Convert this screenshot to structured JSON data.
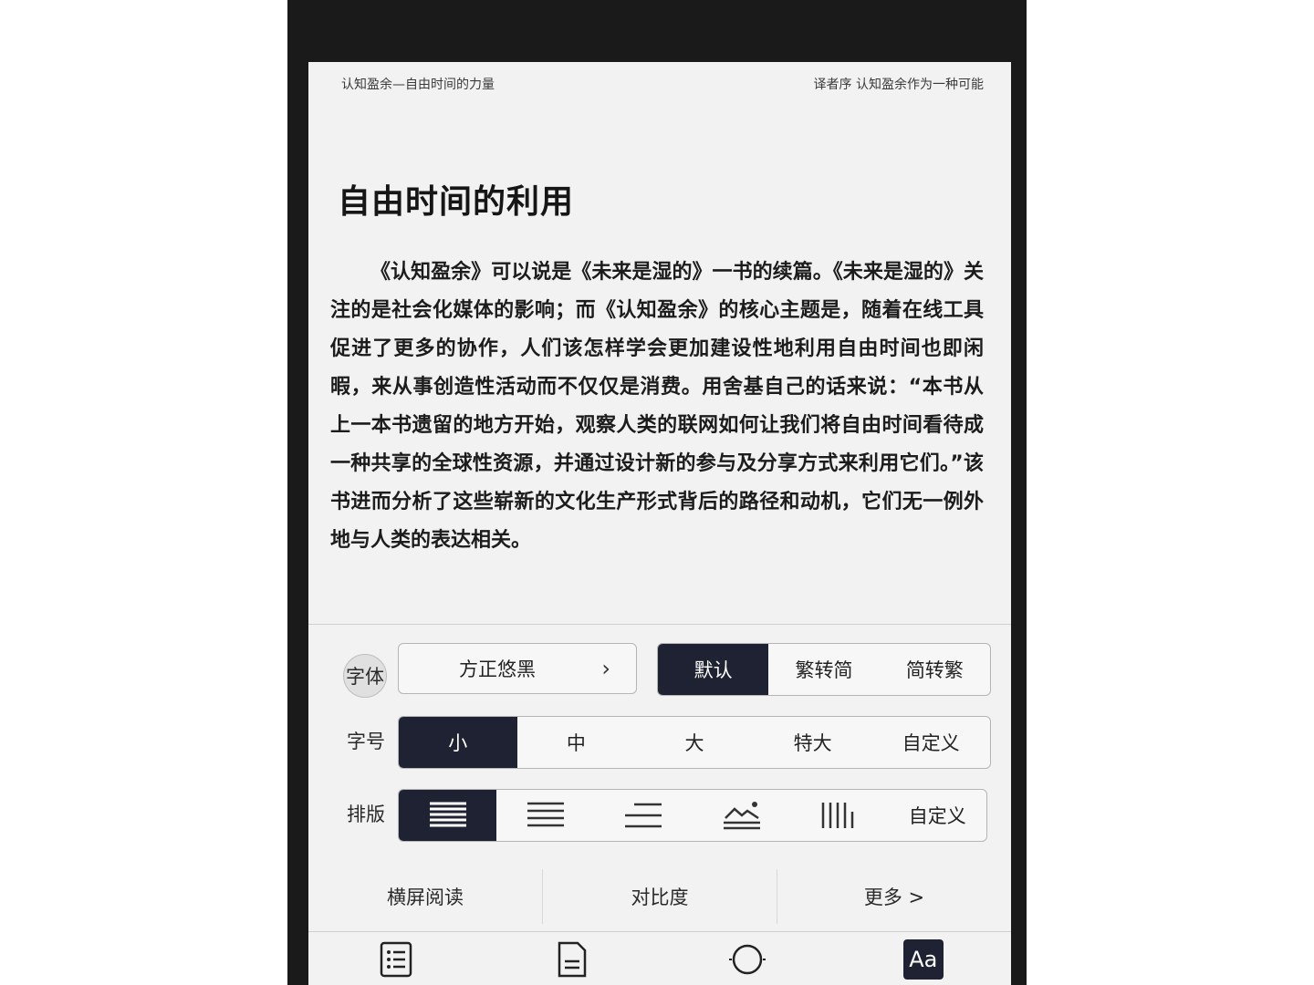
{
  "header": {
    "book_title": "认知盈余—自由时间的力量",
    "chapter": "译者序 认知盈余作为一种可能"
  },
  "content": {
    "title": "自由时间的利用",
    "paragraph": "《认知盈余》可以说是《未来是湿的》一书的续篇。《未来是湿的》关注的是社会化媒体的影响；而《认知盈余》的核心主题是，随着在线工具促进了更多的协作，人们该怎样学会更加建设性地利用自由时间也即闲暇，来从事创造性活动而不仅仅是消费。用舍基自己的话来说：“本书从上一本书遗留的地方开始，观察人类的联网如何让我们将自由时间看待成一种共享的全球性资源，并通过设计新的参与及分享方式来利用它们。”该书进而分析了这些崭新的文化生产形式背后的路径和动机，它们无一例外地与人类的表达相关。"
  },
  "settings": {
    "font_label": "字体",
    "font_value": "方正悠黑",
    "convert_options": [
      "默认",
      "繁转简",
      "简转繁"
    ],
    "size_label": "字号",
    "size_options": [
      "小",
      "中",
      "大",
      "特大",
      "自定义"
    ],
    "layout_label": "排版",
    "layout_custom": "自定义",
    "links": [
      "横屏阅读",
      "对比度",
      "更多 >"
    ]
  },
  "toolbar": {
    "aa_label": "Aa",
    "icons": [
      "toc-icon",
      "page-icon",
      "brightness-icon",
      "font-settings-icon"
    ]
  },
  "colors": {
    "active_bg": "#1e2232",
    "screen_bg": "#f2f2f2"
  }
}
